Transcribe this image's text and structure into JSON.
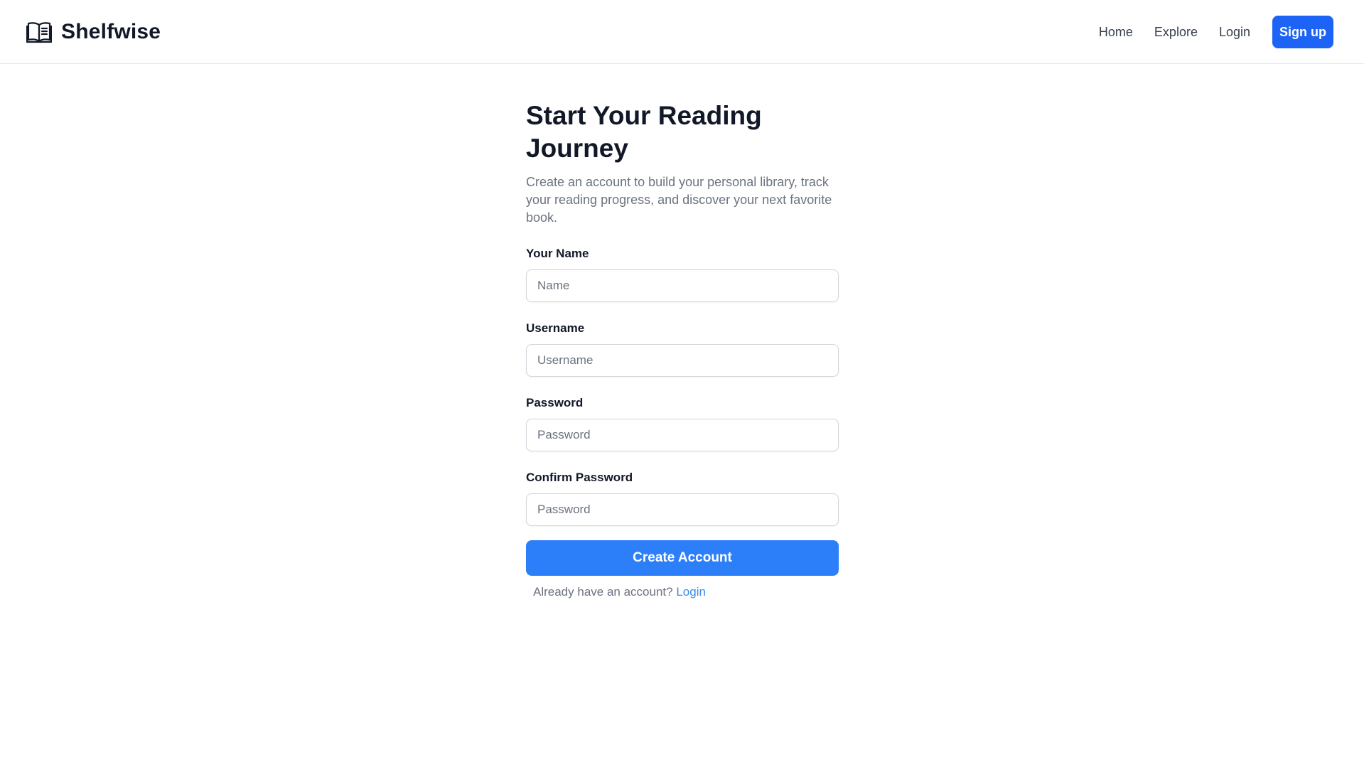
{
  "brand": {
    "name": "Shelfwise",
    "icon": "open-book-icon"
  },
  "nav": {
    "links": [
      "Home",
      "Explore",
      "Login"
    ],
    "signup_label": "Sign up"
  },
  "page": {
    "title": "Start Your Reading Journey",
    "subtitle": "Create an account to build your personal library, track your reading progress, and discover your next favorite book."
  },
  "form": {
    "fields": [
      {
        "label": "Your Name",
        "placeholder": "Name",
        "value": ""
      },
      {
        "label": "Username",
        "placeholder": "Username",
        "value": ""
      },
      {
        "label": "Password",
        "placeholder": "Password",
        "value": ""
      },
      {
        "label": "Confirm Password",
        "placeholder": "Password",
        "value": ""
      }
    ],
    "submit_label": "Create Account",
    "login_prompt": "Already have an account?",
    "login_link": "Login"
  },
  "colors": {
    "primary": "#2d7ff9",
    "signup_button": "#1d63f5",
    "link": "#3b8be8",
    "muted_text": "#6b7280"
  }
}
